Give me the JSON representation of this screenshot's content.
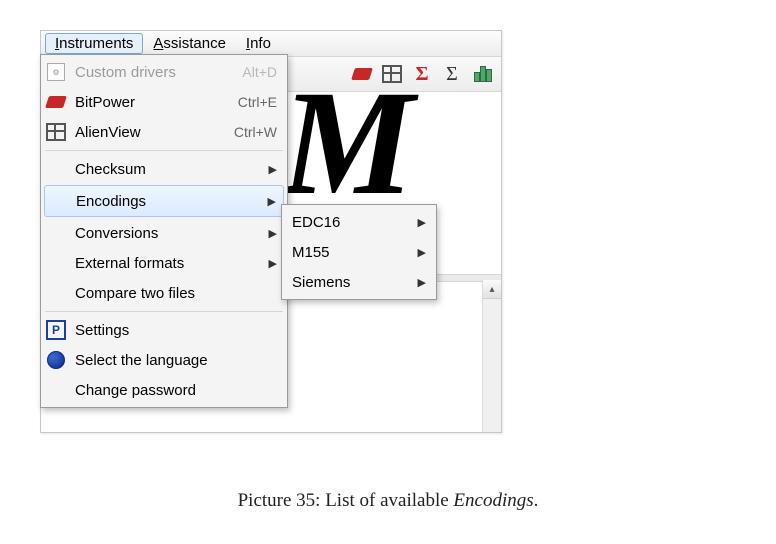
{
  "menubar": {
    "instruments": "Instruments",
    "assistance": "Assistance",
    "info": "Info"
  },
  "menu": {
    "custom_drivers": {
      "label": "Custom drivers",
      "accel": "Alt+D"
    },
    "bitpower": {
      "label": "BitPower",
      "accel": "Ctrl+E"
    },
    "alienview": {
      "label": "AlienView",
      "accel": "Ctrl+W"
    },
    "checksum": {
      "label": "Checksum"
    },
    "encodings": {
      "label": "Encodings"
    },
    "conversions": {
      "label": "Conversions"
    },
    "external_formats": {
      "label": "External formats"
    },
    "compare_two_files": {
      "label": "Compare two files"
    },
    "settings": {
      "label": "Settings"
    },
    "select_language": {
      "label": "Select the language"
    },
    "change_password": {
      "label": "Change password"
    }
  },
  "submenu": {
    "edc16": "EDC16",
    "m155": "M155",
    "siemens": "Siemens"
  },
  "caption": {
    "prefix": "Picture 35: List of available ",
    "emph": "Encodings",
    "suffix": "."
  }
}
